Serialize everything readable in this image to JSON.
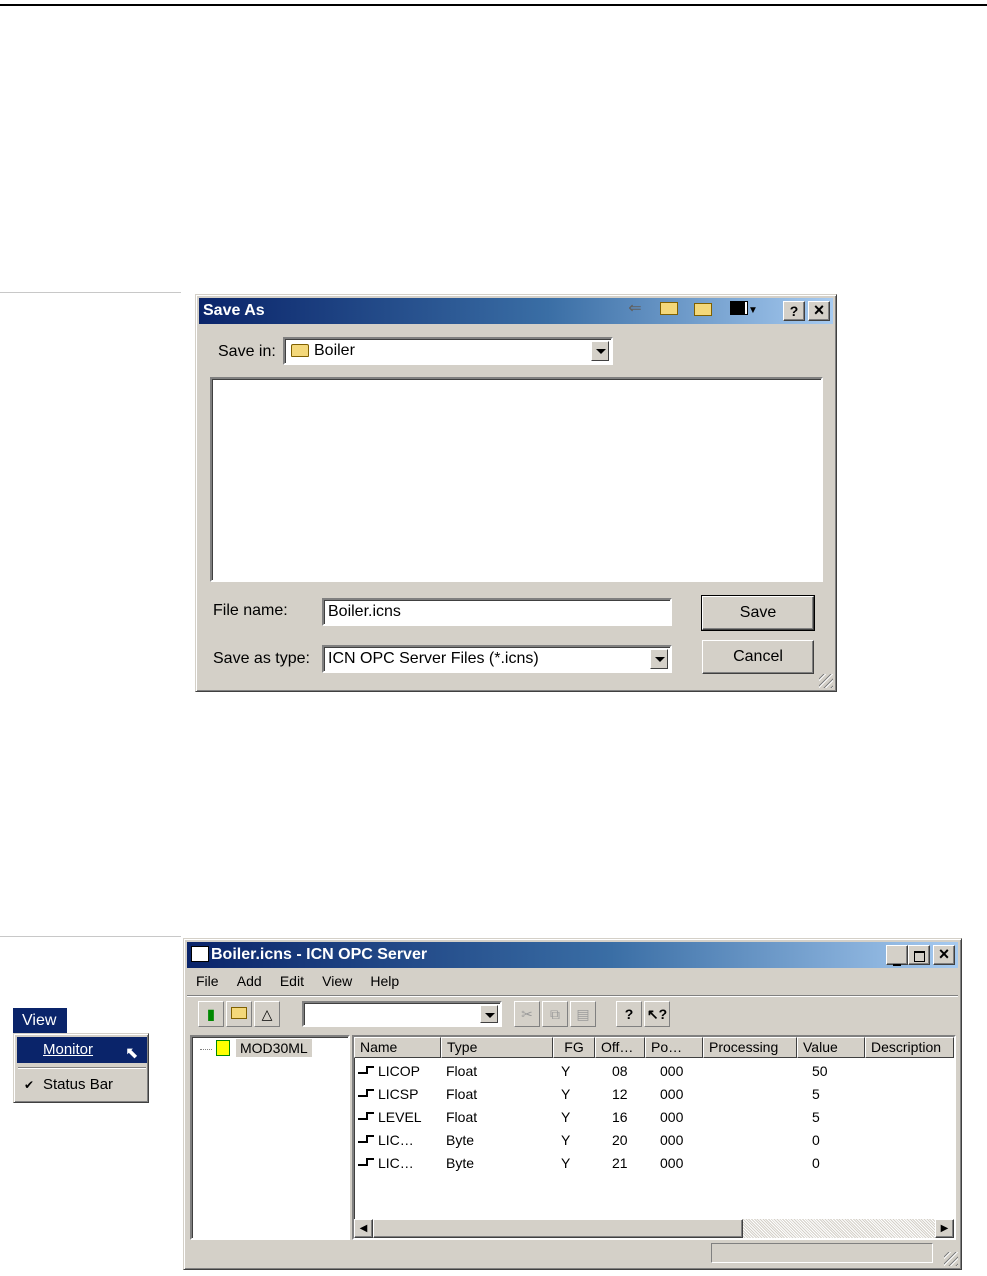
{
  "save_dialog": {
    "title": "Save As",
    "help_btn": "?",
    "close_btn": "×",
    "save_in_label": "Save in:",
    "save_in_value": "Boiler",
    "file_name_label": "File name:",
    "file_name_value": "Boiler.icns",
    "save_type_label": "Save as type:",
    "save_type_value": "ICN OPC Server Files (*.icns)",
    "save_button": "Save",
    "cancel_button": "Cancel"
  },
  "view_menu": {
    "title": "View",
    "items": [
      "Monitor",
      "Status Bar"
    ],
    "checked_mark": "✔"
  },
  "opc_window": {
    "title": "Boiler.icns - ICN OPC Server",
    "menu": [
      "File",
      "Add",
      "Edit",
      "View",
      "Help"
    ],
    "tree_root": "MOD30ML",
    "columns": [
      "Name",
      "Type",
      "FG",
      "Off…",
      "Po…",
      "Processing",
      "Value",
      "Description"
    ],
    "rows": [
      {
        "name": "LICOP",
        "type": "Float",
        "fg": "Y",
        "off": "08",
        "po": "000",
        "processing": "",
        "value": "50",
        "description": ""
      },
      {
        "name": "LICSP",
        "type": "Float",
        "fg": "Y",
        "off": "12",
        "po": "000",
        "processing": "",
        "value": "5",
        "description": ""
      },
      {
        "name": "LEVEL",
        "type": "Float",
        "fg": "Y",
        "off": "16",
        "po": "000",
        "processing": "",
        "value": "5",
        "description": ""
      },
      {
        "name": "LIC…",
        "type": "Byte",
        "fg": "Y",
        "off": "20",
        "po": "000",
        "processing": "",
        "value": "0",
        "description": ""
      },
      {
        "name": "LIC…",
        "type": "Byte",
        "fg": "Y",
        "off": "21",
        "po": "000",
        "processing": "",
        "value": "0",
        "description": ""
      }
    ]
  },
  "colors": {
    "title_active": "#0a246a",
    "face": "#d4d0c8",
    "highlight": "#0a246a"
  }
}
